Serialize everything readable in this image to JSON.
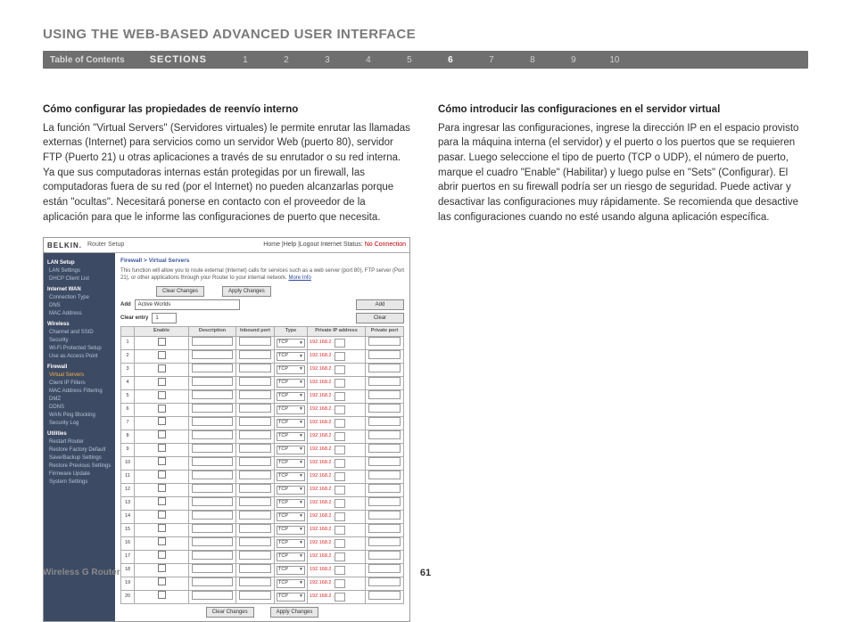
{
  "page_title": "USING THE WEB-BASED ADVANCED USER INTERFACE",
  "nav": {
    "toc": "Table of Contents",
    "sections_label": "SECTIONS",
    "numbers": [
      "1",
      "2",
      "3",
      "4",
      "5",
      "6",
      "7",
      "8",
      "9",
      "10"
    ],
    "active": "6"
  },
  "left": {
    "heading": "Cómo configurar las propiedades de reenvío interno",
    "body": "La función \"Virtual Servers\" (Servidores virtuales) le permite enrutar las llamadas externas (Internet) para servicios como un servidor Web (puerto 80), servidor FTP (Puerto 21) u otras aplicaciones a través de su enrutador o su red interna. Ya que sus computadoras internas están protegidas por un firewall, las computadoras fuera de su red (por el Internet) no pueden alcanzarlas porque están \"ocultas\". Necesitará ponerse en contacto con el proveedor de la aplicación para que le informe las configuraciones de puerto que necesita."
  },
  "right": {
    "heading": "Cómo introducir las configuraciones en el servidor virtual",
    "body": "Para ingresar las configuraciones, ingrese la dirección IP en el espacio provisto para la máquina interna (el servidor) y el puerto o los puertos que se requieren pasar. Luego seleccione el tipo de puerto (TCP o UDP), el número de puerto, marque el cuadro \"Enable\" (Habilitar) y luego pulse en \"Sets\" (Configurar). El abrir puertos en su firewall podría ser un riesgo de seguridad. Puede activar y desactivar las configuraciones muy rápidamente. Se recomienda que desactive las configuraciones cuando no esté usando alguna aplicación específica."
  },
  "screenshot": {
    "brand": "BELKIN.",
    "brand_sub": "Router Setup",
    "status_prefix": "Home |Help |Logout  Internet Status:",
    "status_value": "No Connection",
    "sidebar": {
      "groups": [
        {
          "title": "LAN Setup",
          "items": [
            "LAN Settings",
            "DHCP Client List"
          ]
        },
        {
          "title": "Internet WAN",
          "items": [
            "Connection Type",
            "DNS",
            "MAC Address"
          ]
        },
        {
          "title": "Wireless",
          "items": [
            "Channel and SSID",
            "Security",
            "Wi-Fi Protected Setup",
            "Use as Access Point"
          ]
        },
        {
          "title": "Firewall",
          "items": [
            {
              "t": "Virtual Servers",
              "hi": true
            },
            "Client IP Filters",
            "MAC Address Filtering",
            "DMZ",
            "DDNS",
            "WAN Ping Blocking",
            "Security Log"
          ]
        },
        {
          "title": "Utilities",
          "items": [
            "Restart Router",
            "Restore Factory Default",
            "Save/Backup Settings",
            "Restore Previous Settings",
            "Firmware Update",
            "System Settings"
          ]
        }
      ]
    },
    "crumb": "Firewall > Virtual Servers",
    "desc": "This function will allow you to route external (Internet) calls for services such as a web server (port 80), FTP server (Port 21), or other applications through your Router to your internal network.",
    "more": "More Info",
    "btn_clear_changes": "Clear Changes",
    "btn_apply_changes": "Apply Changes",
    "add_label": "Add",
    "add_select": "Active Worlds",
    "btn_add": "Add",
    "clear_entry_label": "Clear entry",
    "clear_select": "1",
    "btn_clear": "Clear",
    "table": {
      "headers": [
        "Enable",
        "Description",
        "Inbound port",
        "Type",
        "Private IP address",
        "Private port"
      ],
      "ip_prefix": "192.168.2",
      "type_value": "TCP",
      "row_count": 20
    }
  },
  "footer": {
    "product": "Wireless G Router",
    "page": "61"
  }
}
